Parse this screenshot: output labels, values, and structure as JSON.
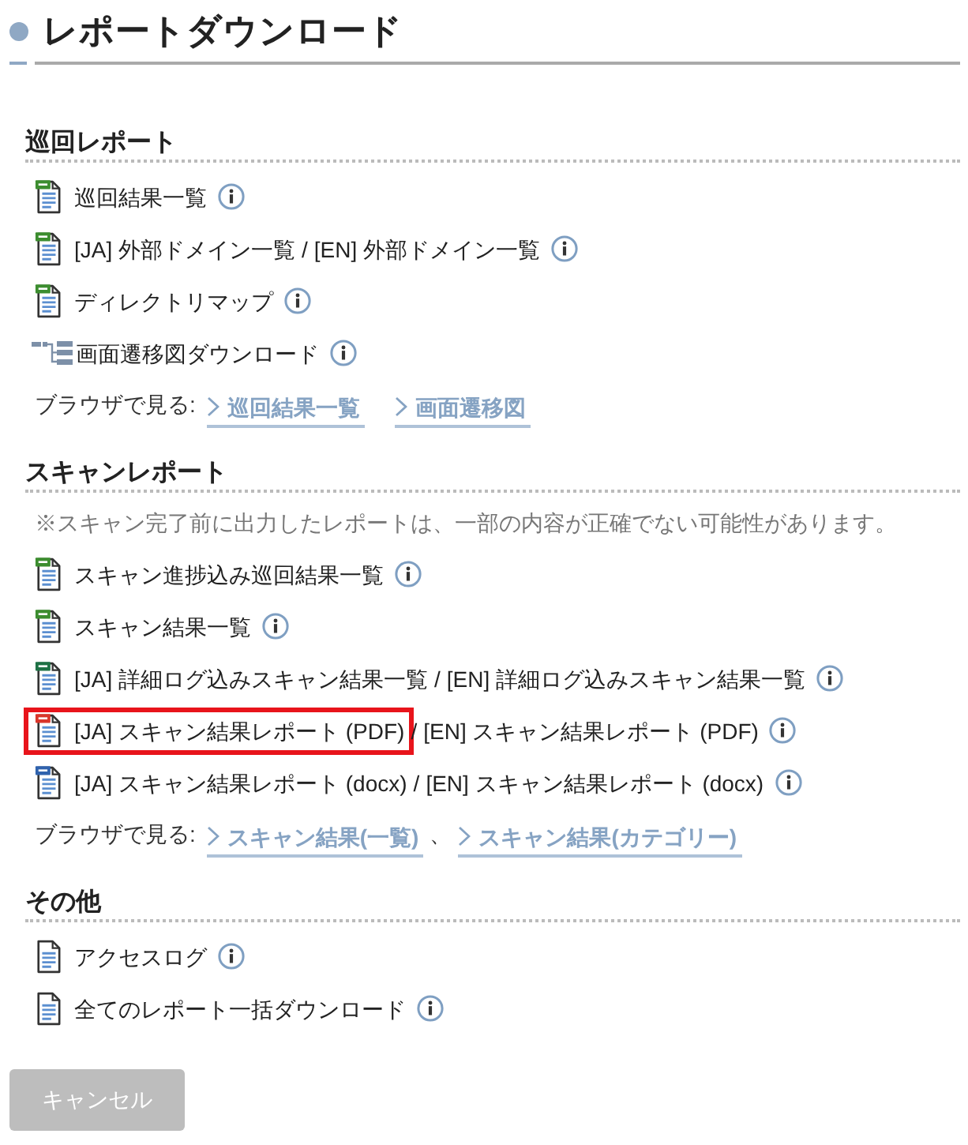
{
  "title": "レポートダウンロード",
  "sections": [
    {
      "heading": "巡回レポート",
      "items": [
        {
          "kind": "csv",
          "links": [
            "巡回結果一覧"
          ],
          "highlighted": false
        },
        {
          "kind": "csv",
          "links": [
            "[JA] 外部ドメイン一覧",
            "[EN] 外部ドメイン一覧"
          ],
          "separator": "/",
          "highlighted": false
        },
        {
          "kind": "csv",
          "links": [
            "ディレクトリマップ"
          ],
          "highlighted": false
        },
        {
          "kind": "flow",
          "links": [
            "画面遷移図ダウンロード"
          ],
          "highlighted": false
        }
      ],
      "browse": {
        "label": "ブラウザで見る:",
        "links": [
          "巡回結果一覧",
          "画面遷移図"
        ]
      }
    },
    {
      "heading": "スキャンレポート",
      "note": "※スキャン完了前に出力したレポートは、一部の内容が正確でない可能性があります。",
      "items": [
        {
          "kind": "csv",
          "links": [
            "スキャン進捗込み巡回結果一覧"
          ],
          "highlighted": false
        },
        {
          "kind": "csv",
          "links": [
            "スキャン結果一覧"
          ],
          "highlighted": false
        },
        {
          "kind": "xlsx",
          "links": [
            "[JA] 詳細ログ込みスキャン結果一覧",
            "[EN] 詳細ログ込みスキャン結果一覧"
          ],
          "separator": "/",
          "highlighted": false
        },
        {
          "kind": "pdf",
          "links": [
            "[JA] スキャン結果レポート (PDF)",
            "[EN] スキャン結果レポート (PDF)"
          ],
          "separator": "/",
          "highlighted": true
        },
        {
          "kind": "docx",
          "links": [
            "[JA] スキャン結果レポート (docx)",
            "[EN] スキャン結果レポート (docx)"
          ],
          "separator": "/",
          "highlighted": false
        }
      ],
      "browse": {
        "label": "ブラウザで見る:",
        "links": [
          "スキャン結果(一覧)",
          "スキャン結果(カテゴリー)"
        ],
        "separator": "、"
      }
    },
    {
      "heading": "その他",
      "items": [
        {
          "kind": "doc",
          "links": [
            "アクセスログ"
          ],
          "highlighted": false
        },
        {
          "kind": "doc",
          "links": [
            "全てのレポート一括ダウンロード"
          ],
          "highlighted": false
        }
      ]
    }
  ],
  "cancel_button": {
    "label": "キャンセル",
    "disabled": true
  }
}
